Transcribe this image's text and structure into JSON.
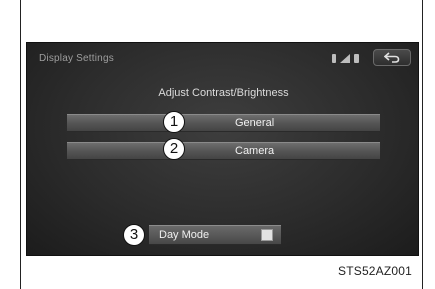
{
  "screen": {
    "title": "Display Settings",
    "heading": "Adjust Contrast/Brightness",
    "status_icons": [
      "bluetooth-icon",
      "signal-icon",
      "battery-icon"
    ],
    "back_icon": "back-arrow-icon"
  },
  "menu": [
    {
      "callout": "1",
      "label": "General"
    },
    {
      "callout": "2",
      "label": "Camera"
    }
  ],
  "day_mode": {
    "callout": "3",
    "label": "Day Mode",
    "toggle_state": "off"
  },
  "figure_id": "STS52AZ001",
  "colors": {
    "screen_bg": "#2c2c2c",
    "button_bg": "#555555",
    "text": "#f2f2f2",
    "title_text": "#9e9e9e"
  }
}
